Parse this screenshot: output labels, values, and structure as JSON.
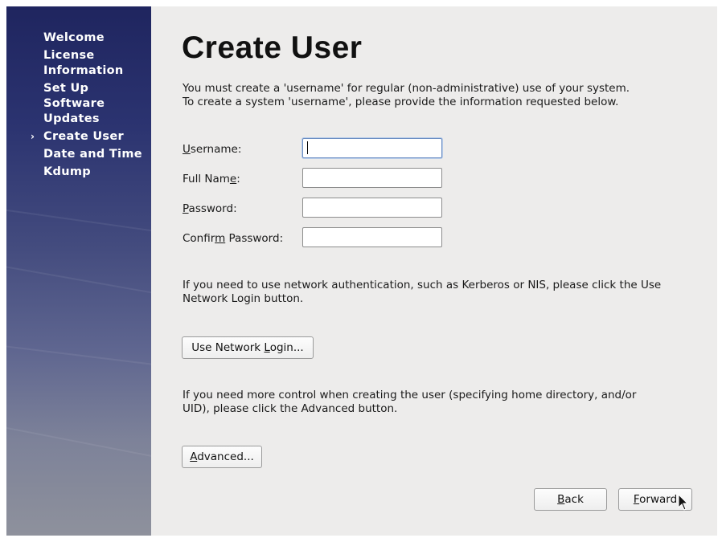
{
  "sidebar": {
    "steps": [
      {
        "label": "Welcome",
        "current": false
      },
      {
        "label": "License Information",
        "current": false
      },
      {
        "label": "Set Up Software Updates",
        "current": false
      },
      {
        "label": "Create User",
        "current": true
      },
      {
        "label": "Date and Time",
        "current": false
      },
      {
        "label": "Kdump",
        "current": false
      }
    ],
    "current_marker": "›"
  },
  "page": {
    "title": "Create User",
    "intro": "You must create a 'username' for regular (non-administrative) use of your system.  To create a system 'username', please provide the information requested below.",
    "network_text": "If you need to use network authentication, such as Kerberos or NIS, please click the Use Network Login button.",
    "advanced_text": "If you need more control when creating the user (specifying home directory, and/or UID), please click the Advanced button."
  },
  "form": {
    "username_label": {
      "pre": "",
      "key": "U",
      "post": "sername:"
    },
    "fullname_label": {
      "pre": "Full Nam",
      "key": "e",
      "post": ":"
    },
    "password_label": {
      "pre": "",
      "key": "P",
      "post": "assword:"
    },
    "confirm_label": {
      "pre": "Confir",
      "key": "m",
      "post": " Password:"
    },
    "username_value": "",
    "fullname_value": "",
    "password_value": "",
    "confirm_value": ""
  },
  "buttons": {
    "network_login": {
      "pre": "Use Network ",
      "key": "L",
      "post": "ogin..."
    },
    "advanced": {
      "pre": "",
      "key": "A",
      "post": "dvanced..."
    },
    "back": {
      "pre": "",
      "key": "B",
      "post": "ack"
    },
    "forward": {
      "pre": "",
      "key": "F",
      "post": "orward"
    }
  },
  "icons": {
    "current_step_marker": "chevron-right-icon",
    "mouse_pointer": "cursor-arrow-icon"
  },
  "colors": {
    "sidebar_top": "#1f255f",
    "sidebar_bottom": "#8e919c",
    "content_bg": "#edeceb",
    "focus_border": "#6d8fc4"
  }
}
